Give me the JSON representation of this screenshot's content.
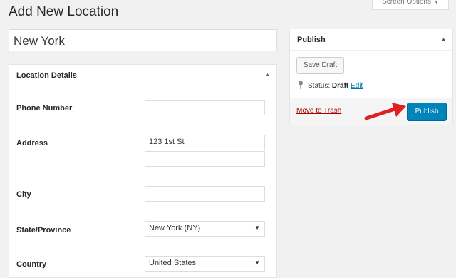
{
  "header": {
    "title": "Add New Location",
    "screen_options": "Screen Options"
  },
  "title_field": {
    "value": "New York"
  },
  "location_details": {
    "heading": "Location Details",
    "fields": {
      "phone_label": "Phone Number",
      "phone_value": "",
      "address_label": "Address",
      "address_line1": "123 1st St",
      "address_line2": "",
      "city_label": "City",
      "city_value": "",
      "state_label": "State/Province",
      "state_value": "New York (NY)",
      "country_label": "Country",
      "country_value": "United States"
    }
  },
  "publish_box": {
    "heading": "Publish",
    "save_draft": "Save Draft",
    "status_label": "Status:",
    "status_value": "Draft",
    "edit_link": "Edit",
    "trash_link": "Move to Trash",
    "publish_button": "Publish"
  },
  "colors": {
    "primary_button": "#0085ba",
    "link": "#0073aa",
    "trash": "#aa0000",
    "annotation_arrow": "#e02020"
  }
}
